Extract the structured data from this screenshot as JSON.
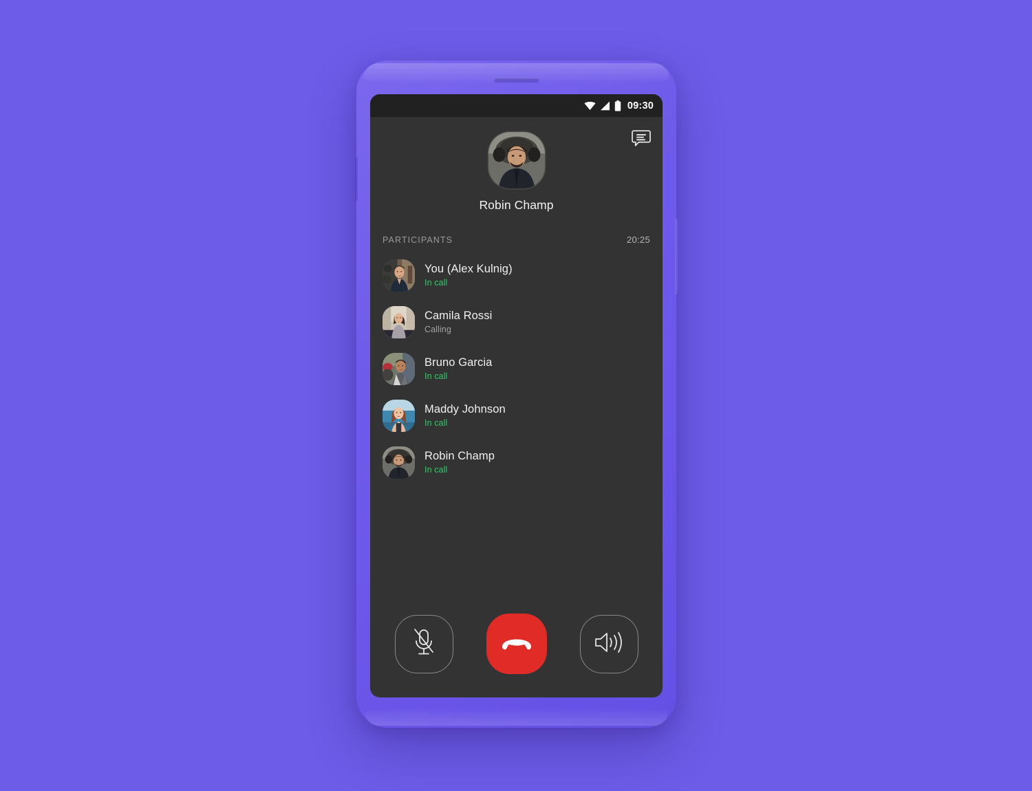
{
  "theme": {
    "page_background": "#6c5ce7",
    "phone_body": "#7059ea",
    "screen_background": "#333333",
    "status_bar_background": "#212121",
    "accent_green": "#3ec46d",
    "end_call_red": "#e02b26"
  },
  "status_bar": {
    "clock": "09:30",
    "icons": [
      "wifi-icon",
      "cellular-signal-icon",
      "battery-icon"
    ]
  },
  "header": {
    "chat_icon": "chat-bubble-icon",
    "caller_name": "Robin Champ",
    "caller_avatar": "avatar-robin-champ"
  },
  "participants_section": {
    "label": "PARTICIPANTS",
    "timer": "20:25",
    "items": [
      {
        "name": "You (Alex Kulnig)",
        "status": "In call",
        "state": "in-call",
        "avatar": "avatar-alex-kulnig"
      },
      {
        "name": "Camila Rossi",
        "status": "Calling",
        "state": "calling",
        "avatar": "avatar-camila-rossi"
      },
      {
        "name": "Bruno Garcia",
        "status": "In call",
        "state": "in-call",
        "avatar": "avatar-bruno-garcia"
      },
      {
        "name": "Maddy Johnson",
        "status": "In call",
        "state": "in-call",
        "avatar": "avatar-maddy-johnson"
      },
      {
        "name": "Robin Champ",
        "status": "In call",
        "state": "in-call",
        "avatar": "avatar-robin-champ"
      }
    ]
  },
  "call_controls": {
    "mute": {
      "icon": "microphone-muted-icon",
      "label": "Mute"
    },
    "end_call": {
      "icon": "phone-hangup-icon",
      "label": "End call"
    },
    "speaker": {
      "icon": "speaker-loud-icon",
      "label": "Speaker"
    }
  }
}
